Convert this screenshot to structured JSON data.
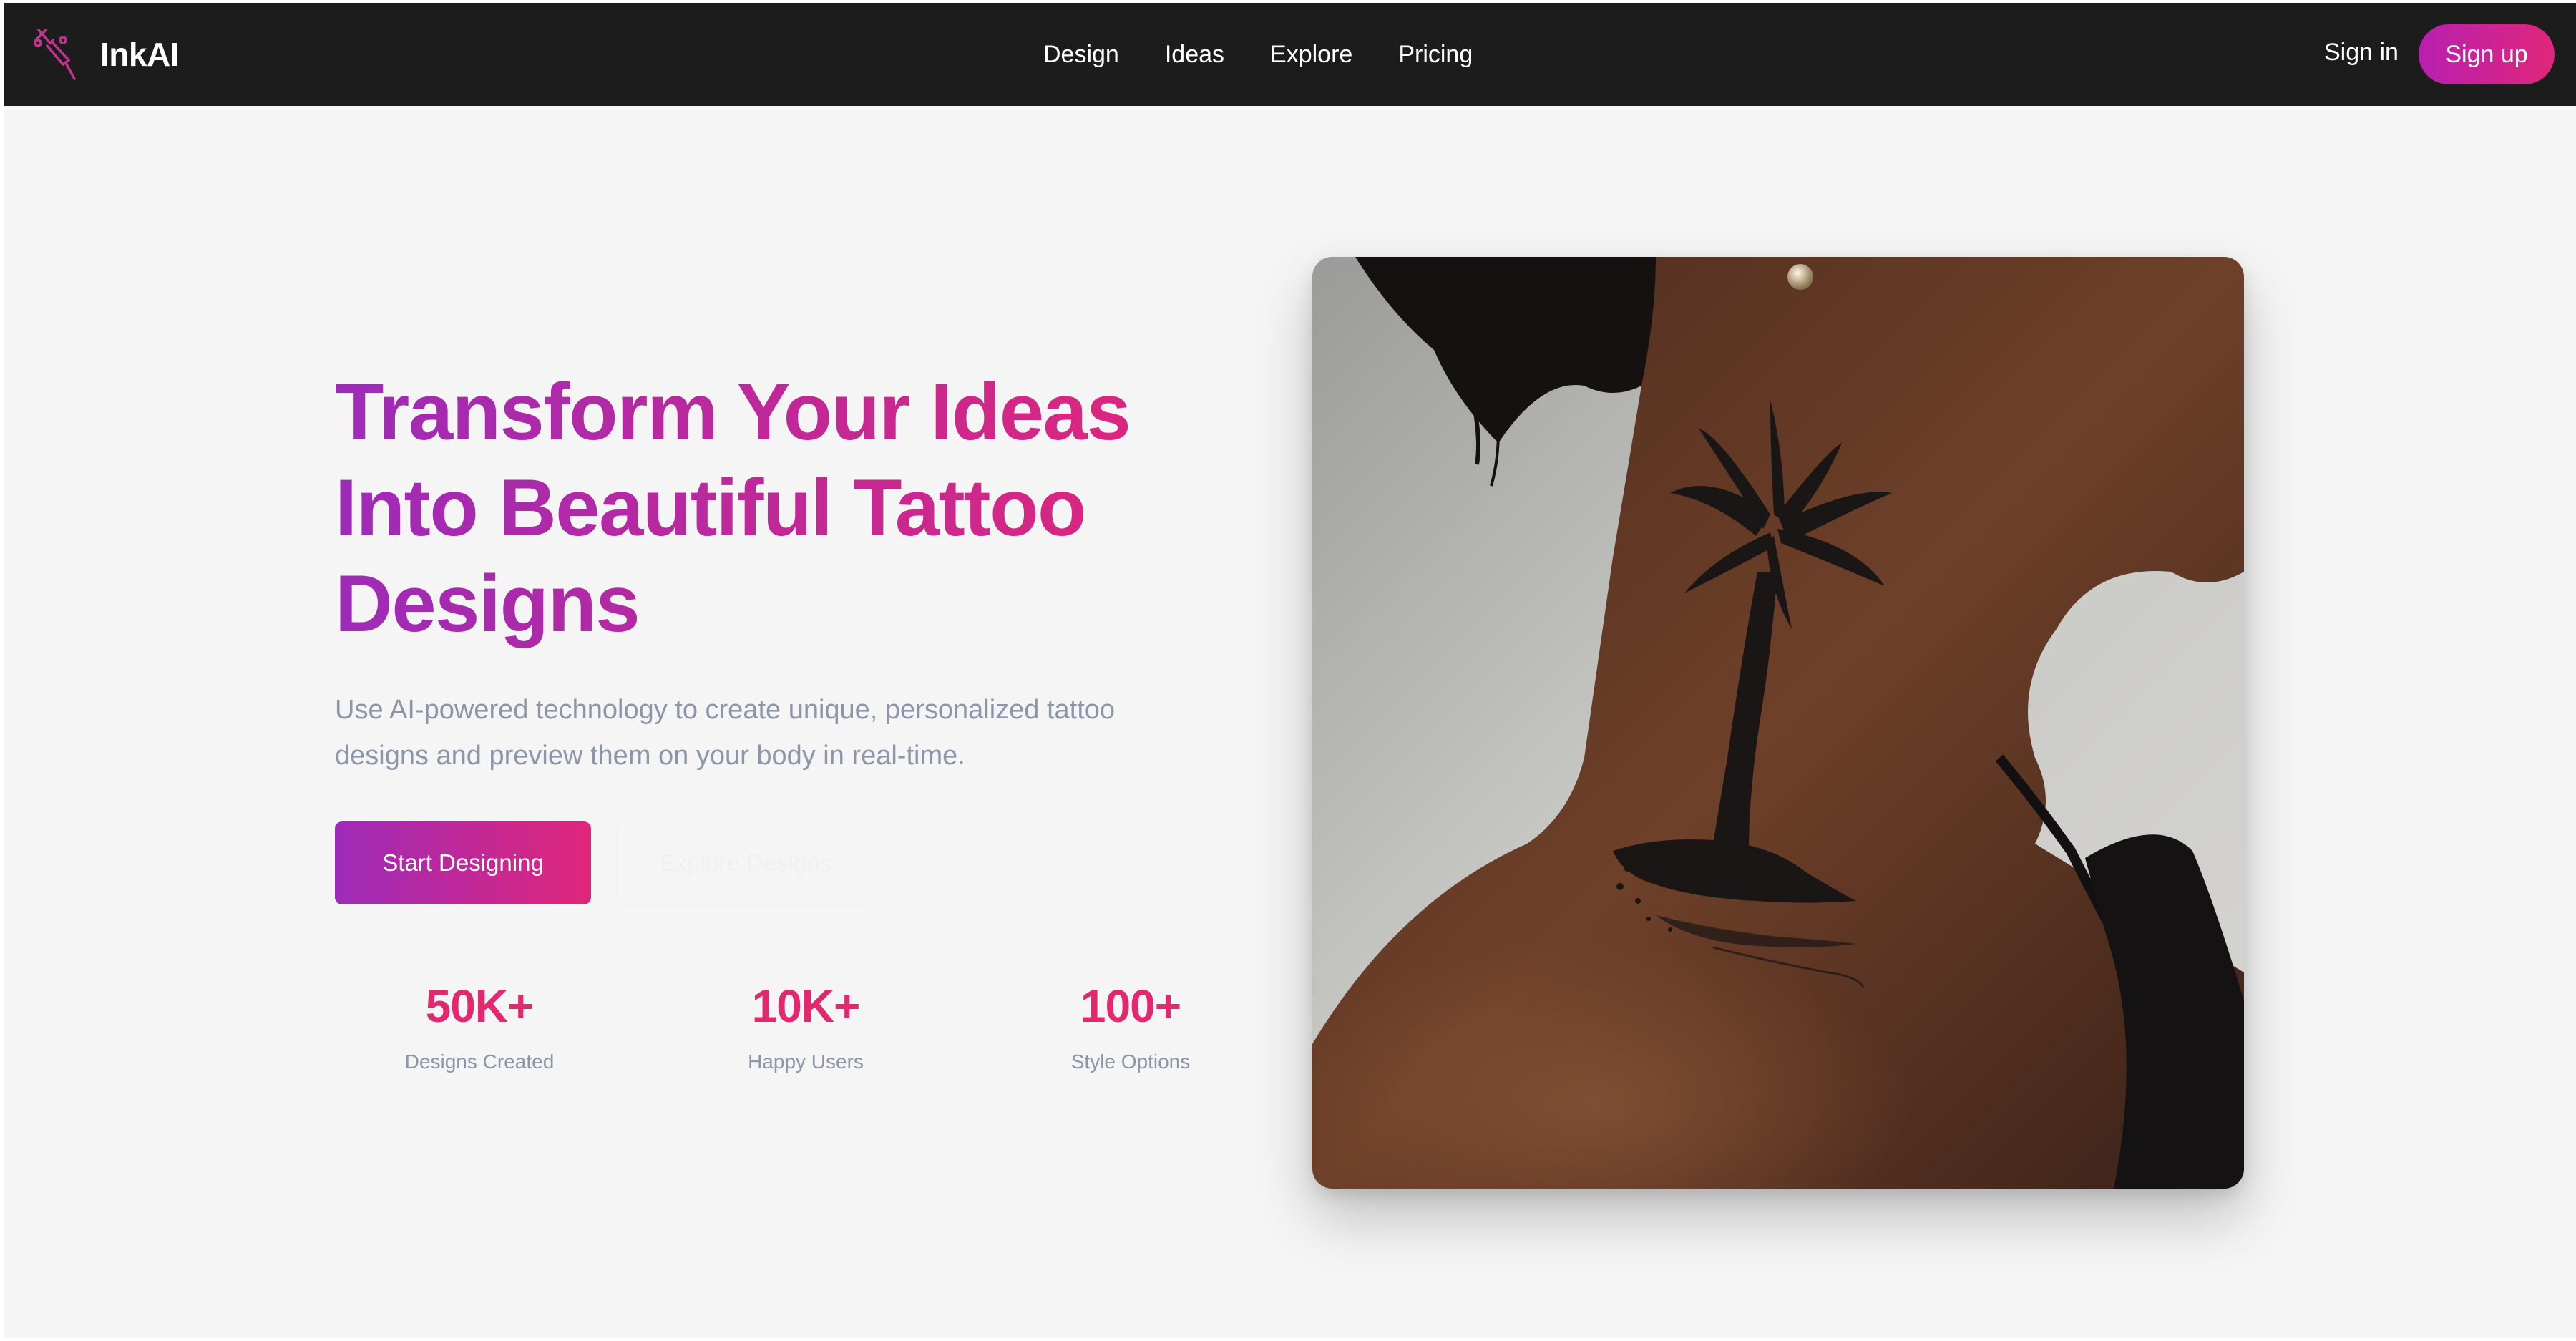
{
  "brand": {
    "name": "InkAI",
    "icon": "tattoo-machine-icon"
  },
  "nav": {
    "links": [
      "Design",
      "Ideas",
      "Explore",
      "Pricing"
    ],
    "signin": "Sign in",
    "signup": "Sign up"
  },
  "hero": {
    "title_line1": "Transform Your Ideas",
    "title_line2": "Into Beautiful Tattoo",
    "title_line3": "Designs",
    "subtitle_line1": "Use AI-powered technology to create unique, personalized tattoo",
    "subtitle_line2": "designs and preview them on your body in real-time.",
    "primary_button": "Start Designing",
    "secondary_button": "Explore Designs"
  },
  "stats": [
    {
      "value": "50K+",
      "label": "Designs Created"
    },
    {
      "value": "10K+",
      "label": "Happy Users"
    },
    {
      "value": "100+",
      "label": "Style Options"
    }
  ],
  "colors": {
    "nav_bg": "#1c1c1c",
    "accent_start": "#9d2bb8",
    "accent_end": "#e0267a",
    "stat_value": "#e2286f",
    "muted_text": "#8c96a8",
    "page_bg": "#f5f5f5"
  }
}
